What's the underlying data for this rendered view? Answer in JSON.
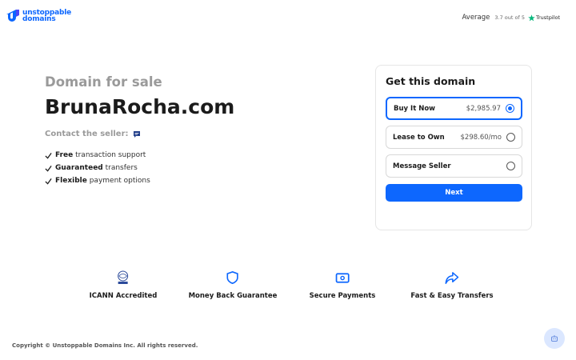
{
  "brand": {
    "line1": "unstoppable",
    "line2": "domains",
    "color": "#0d67fe"
  },
  "rating": {
    "label": "Average",
    "score": "3.7 out of 5",
    "provider": "Trustpilot",
    "star_color": "#00b67a"
  },
  "hero": {
    "subtitle": "Domain for sale",
    "domain": "BrunaRocha.com",
    "contact_label": "Contact the seller:",
    "features": [
      {
        "bold": "Free",
        "rest": " transaction support"
      },
      {
        "bold": "Guaranteed",
        "rest": " transfers"
      },
      {
        "bold": "Flexible",
        "rest": " payment options"
      }
    ]
  },
  "card": {
    "title": "Get this domain",
    "options": [
      {
        "label": "Buy It Now",
        "price": "$2,985.97",
        "selected": true
      },
      {
        "label": "Lease to Own",
        "price": "$298.60/mo",
        "selected": false
      },
      {
        "label": "Message Seller",
        "price": "",
        "selected": false
      }
    ],
    "next_label": "Next"
  },
  "badges": [
    {
      "label": "ICANN Accredited",
      "icon": "icann-logo-icon"
    },
    {
      "label": "Money Back Guarantee",
      "icon": "shield-icon"
    },
    {
      "label": "Secure Payments",
      "icon": "payment-card-icon"
    },
    {
      "label": "Fast & Easy Transfers",
      "icon": "share-arrow-icon"
    }
  ],
  "footer": {
    "copyright": "Copyright © Unstoppable Domains Inc. All rights reserved."
  }
}
